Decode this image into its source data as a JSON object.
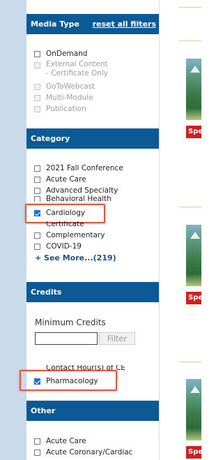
{
  "media_type": {
    "title": "Media Type",
    "reset_label": "reset all filters",
    "options": [
      {
        "label": "OnDemand"
      },
      {
        "label": "External Content - Certificate Only"
      },
      {
        "label": "GoToWebcast"
      },
      {
        "label": "Multi-Module"
      },
      {
        "label": "Publication"
      }
    ]
  },
  "category": {
    "title": "Category",
    "options": [
      {
        "label": "2021 Fall Conference"
      },
      {
        "label": "Acute Care"
      },
      {
        "label": "Advanced Specialty"
      },
      {
        "label": "Behavioral Health"
      },
      {
        "label": "Cardiology"
      },
      {
        "label": "Certificate"
      },
      {
        "label": "Complementary"
      },
      {
        "label": "COVID-19"
      }
    ],
    "see_more": "+ See More...(219)"
  },
  "credits": {
    "title": "Credits",
    "min_label": "Minimum Credits",
    "min_value": "",
    "filter_label": "Filter",
    "options": [
      {
        "label": "Contact Hour(s) of CE"
      },
      {
        "label": "Pharmacology"
      }
    ]
  },
  "other": {
    "title": "Other",
    "options": [
      {
        "label": "Acute Care"
      },
      {
        "label": "Acute Coronary/Cardiac"
      }
    ]
  },
  "results": {
    "tag_label": "Spe"
  },
  "colors": {
    "header_bg": "#0b5a96",
    "highlight": "#e2553f",
    "tag_bg": "#cf1f1f",
    "link": "#1f4f8f"
  }
}
